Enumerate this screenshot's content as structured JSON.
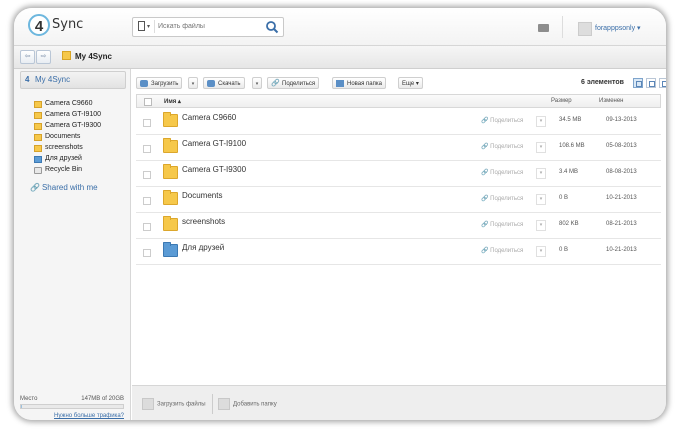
{
  "brand": {
    "logo_digit": "4",
    "logo_word": "Sync"
  },
  "search": {
    "placeholder": "Искать файлы",
    "type_dropdown": "▾"
  },
  "user": {
    "name": "forapppsonly ▾"
  },
  "breadcrumb": {
    "title": "My 4Sync"
  },
  "sidebar": {
    "root_label": "My 4Sync",
    "items": [
      {
        "label": "Camera C9660",
        "icon": "folder-icon"
      },
      {
        "label": "Camera GT-I9100",
        "icon": "folder-icon"
      },
      {
        "label": "Camera GT-I9300",
        "icon": "folder-icon"
      },
      {
        "label": "Documents",
        "icon": "folder-icon"
      },
      {
        "label": "screenshots",
        "icon": "folder-icon"
      },
      {
        "label": "Для друзей",
        "icon": "shared-folder-icon"
      },
      {
        "label": "Recycle Bin",
        "icon": "recycle-bin-icon"
      }
    ],
    "shared_label": "Shared with me",
    "quota": {
      "label": "Место",
      "value": "147MB of 20GB",
      "used_fraction": 0.007,
      "more_link": "Нужно больше трафика?"
    }
  },
  "toolbar": {
    "upload": "Загрузить",
    "download": "Скачать",
    "share": "Поделиться",
    "new_folder": "Новая папка",
    "more": "Еще",
    "count": "6 элементов"
  },
  "table": {
    "headers": {
      "name": "Имя ▴",
      "size": "Размер",
      "modified": "Изменен"
    },
    "share_label": "Поделиться",
    "rows": [
      {
        "name": "Camera C9660",
        "size": "34.5 MB",
        "date": "09-13-2013",
        "type": "folder"
      },
      {
        "name": "Camera GT-I9100",
        "size": "108.6 MB",
        "date": "05-08-2013",
        "type": "folder"
      },
      {
        "name": "Camera GT-I9300",
        "size": "3.4 MB",
        "date": "08-08-2013",
        "type": "folder"
      },
      {
        "name": "Documents",
        "size": "0 B",
        "date": "10-21-2013",
        "type": "folder"
      },
      {
        "name": "screenshots",
        "size": "802 KB",
        "date": "08-21-2013",
        "type": "folder"
      },
      {
        "name": "Для друзей",
        "size": "0 B",
        "date": "10-21-2013",
        "type": "shared-folder"
      }
    ]
  },
  "bottom": {
    "upload_files": "Загрузить файлы",
    "add_folder": "Добавить папку"
  },
  "colors": {
    "accent": "#3a6ea8",
    "folder": "#f6c84a",
    "shared_folder": "#5b9bd5"
  }
}
